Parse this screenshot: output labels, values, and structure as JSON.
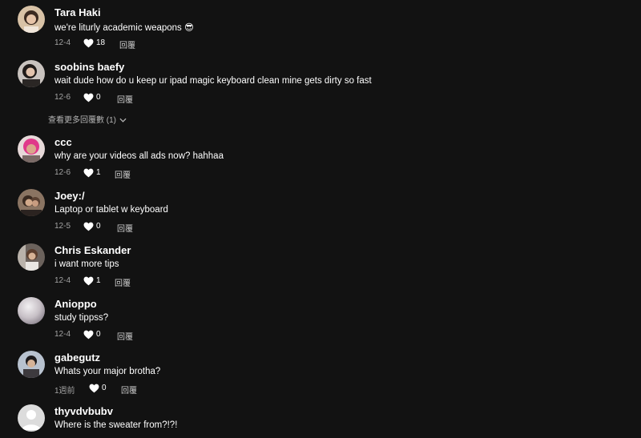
{
  "icons": {
    "like": "heart-outline-icon",
    "expand": "chevron-down-icon"
  },
  "colors": {
    "background": "#121212",
    "secondary_text": "#a3a3a3"
  },
  "comments": [
    {
      "username": "Tara Haki",
      "text": "we're liturly academic weapons 😎",
      "date": "12-4",
      "likes": "18",
      "reply": "回覆"
    },
    {
      "username": "soobins baefy",
      "text": "wait dude how do u keep ur ipad magic keyboard clean mine gets dirty so fast",
      "date": "12-6",
      "likes": "0",
      "reply": "回覆"
    },
    {
      "username": "ccc",
      "text": "why are your videos all ads now? hahhaa",
      "date": "12-6",
      "likes": "1",
      "reply": "回覆"
    },
    {
      "username": "Joey:/",
      "text": "Laptop or tablet w keyboard",
      "date": "12-5",
      "likes": "0",
      "reply": "回覆"
    },
    {
      "username": "Chris Eskander",
      "text": "i want more tips",
      "date": "12-4",
      "likes": "1",
      "reply": "回覆"
    },
    {
      "username": "Anioppo",
      "text": "study tippss?",
      "date": "12-4",
      "likes": "0",
      "reply": "回覆"
    },
    {
      "username": "gabegutz",
      "text": "Whats your major brotha?",
      "date": "1週前",
      "likes": "0",
      "reply": "回覆"
    },
    {
      "username": "thyvdvbubv",
      "text": "Where is the sweater from?!?!",
      "date": "",
      "likes": "",
      "reply": ""
    }
  ],
  "view_more_replies": "查看更多回覆數 (1)"
}
